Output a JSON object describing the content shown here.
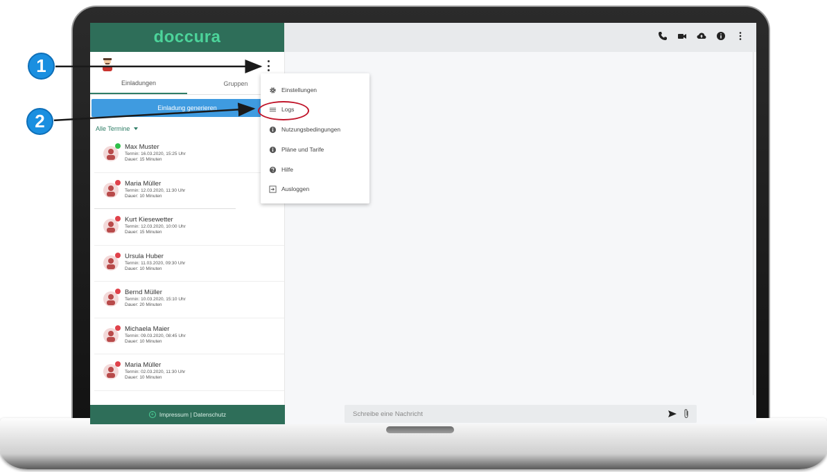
{
  "app": {
    "brand": "doccura",
    "colors": {
      "brand_green": "#2e6e59",
      "accent_green": "#4cd39a",
      "button_blue": "#3f9be0",
      "status_online": "#2fbf4a",
      "status_offline": "#e0424b",
      "highlight_red": "#c0152a",
      "annotation_blue": "#1a8fe0"
    }
  },
  "sidebar": {
    "tabs": [
      {
        "label": "Einladungen",
        "active": true
      },
      {
        "label": "Gruppen",
        "active": false
      }
    ],
    "generate_button": "Einladung generieren",
    "filter_label": "Alle Termine",
    "appointments": [
      {
        "name": "Max Muster",
        "termin": "Termin: 16.03.2020, 15:25 Uhr",
        "dauer": "Dauer: 15 Minuten",
        "status": "online"
      },
      {
        "name": "Maria Müller",
        "termin": "Termin: 12.03.2020, 11:30 Uhr",
        "dauer": "Dauer: 10 Minuten",
        "status": "offline"
      },
      {
        "name": "Kurt Kiesewetter",
        "termin": "Termin: 12.03.2020, 10:00 Uhr",
        "dauer": "Dauer: 15 Minuten",
        "status": "offline"
      },
      {
        "name": "Ursula Huber",
        "termin": "Termin: 11.03.2020, 09:30 Uhr",
        "dauer": "Dauer: 10 Minuten",
        "status": "offline"
      },
      {
        "name": "Bernd Müller",
        "termin": "Termin: 10.03.2020, 15:10 Uhr",
        "dauer": "Dauer: 20 Minuten",
        "status": "offline"
      },
      {
        "name": "Michaela Maier",
        "termin": "Termin: 09.03.2020, 08:45 Uhr",
        "dauer": "Dauer: 10 Minuten",
        "status": "offline"
      },
      {
        "name": "Maria Müller",
        "termin": "Termin: 02.03.2020, 11:30 Uhr",
        "dauer": "Dauer: 10 Minuten",
        "status": "offline"
      }
    ],
    "footer": "Impressum | Datenschutz"
  },
  "menu": {
    "items": [
      {
        "label": "Einstellungen",
        "icon": "gear-icon"
      },
      {
        "label": "Logs",
        "icon": "list-icon",
        "highlighted": true
      },
      {
        "label": "Nutzungsbedingungen",
        "icon": "info-icon"
      },
      {
        "label": "Pläne und Tarife",
        "icon": "info-icon"
      },
      {
        "label": "Hilfe",
        "icon": "help-icon"
      },
      {
        "label": "Ausloggen",
        "icon": "logout-icon"
      }
    ]
  },
  "topbar": {
    "icons": [
      "phone-icon",
      "video-icon",
      "cloud-upload-icon",
      "info-icon",
      "more-vert-icon"
    ]
  },
  "composer": {
    "placeholder": "Schreibe eine Nachricht"
  },
  "annotations": {
    "step1": "1",
    "step2": "2"
  }
}
